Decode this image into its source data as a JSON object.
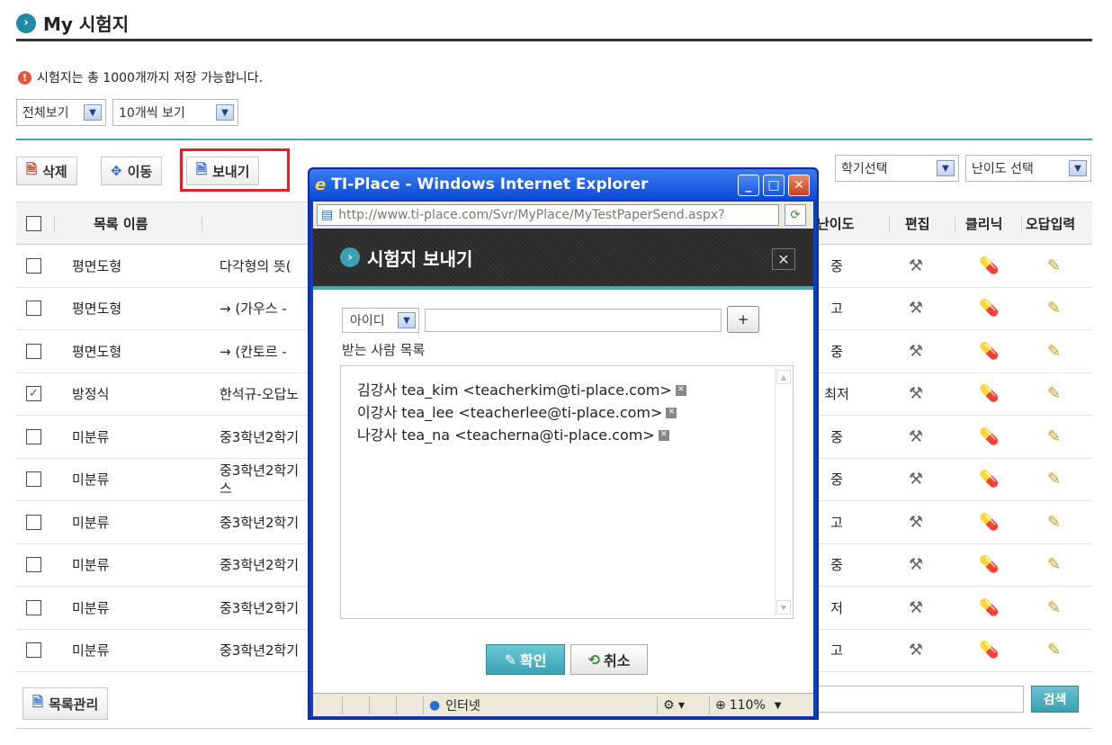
{
  "header": {
    "title": "My 시험지"
  },
  "notice": "시험지는 총 1000개까지 저장 가능합니다.",
  "filters": {
    "view_all": "전체보기",
    "per_page": "10개씩 보기",
    "semester": "학기선택",
    "difficulty": "난이도 선택"
  },
  "toolbar": {
    "delete": "삭제",
    "move": "이동",
    "send": "보내기"
  },
  "table": {
    "headers": {
      "name": "목록 이름",
      "difficulty": "난이도",
      "edit": "편집",
      "clinic": "클리닉",
      "wrong": "오답입력"
    },
    "rows": [
      {
        "checked": false,
        "category": "평면도형",
        "title": "다각형의 뜻(",
        "difficulty": "중"
      },
      {
        "checked": false,
        "category": "평면도형",
        "title": "→ (가우스 -",
        "difficulty": "고"
      },
      {
        "checked": false,
        "category": "평면도형",
        "title": "→ (칸토르 -",
        "difficulty": "중"
      },
      {
        "checked": true,
        "category": "방정식",
        "title": "한석규-오답노",
        "difficulty": "최저"
      },
      {
        "checked": false,
        "category": "미분류",
        "title": "중3학년2학기",
        "difficulty": "중"
      },
      {
        "checked": false,
        "category": "미분류",
        "title": "중3학년2학기",
        "title2": "스",
        "difficulty": "중"
      },
      {
        "checked": false,
        "category": "미분류",
        "title": "중3학년2학기",
        "difficulty": "고"
      },
      {
        "checked": false,
        "category": "미분류",
        "title": "중3학년2학기",
        "difficulty": "중"
      },
      {
        "checked": false,
        "category": "미분류",
        "title": "중3학년2학기",
        "difficulty": "저"
      },
      {
        "checked": false,
        "category": "미분류",
        "title": "중3학년2학기",
        "difficulty": "고"
      }
    ]
  },
  "bottom": {
    "manage": "목록관리",
    "search": "검색"
  },
  "popup": {
    "window_title": "TI-Place - Windows Internet Explorer",
    "url": "http://www.ti-place.com/Svr/MyPlace/MyTestPaperSend.aspx?",
    "dialog_title": "시험지 보내기",
    "id_select": "아이디",
    "add": "+",
    "recipients_label": "받는 사람 목록",
    "recipients": [
      "김강사 tea_kim <teacherkim@ti-place.com>",
      "이강사 tea_lee <teacherlee@ti-place.com>",
      "나강사 tea_na <teacherna@ti-place.com>"
    ],
    "ok": "확인",
    "cancel": "취소",
    "status_zone": "인터넷",
    "zoom": "110%"
  }
}
